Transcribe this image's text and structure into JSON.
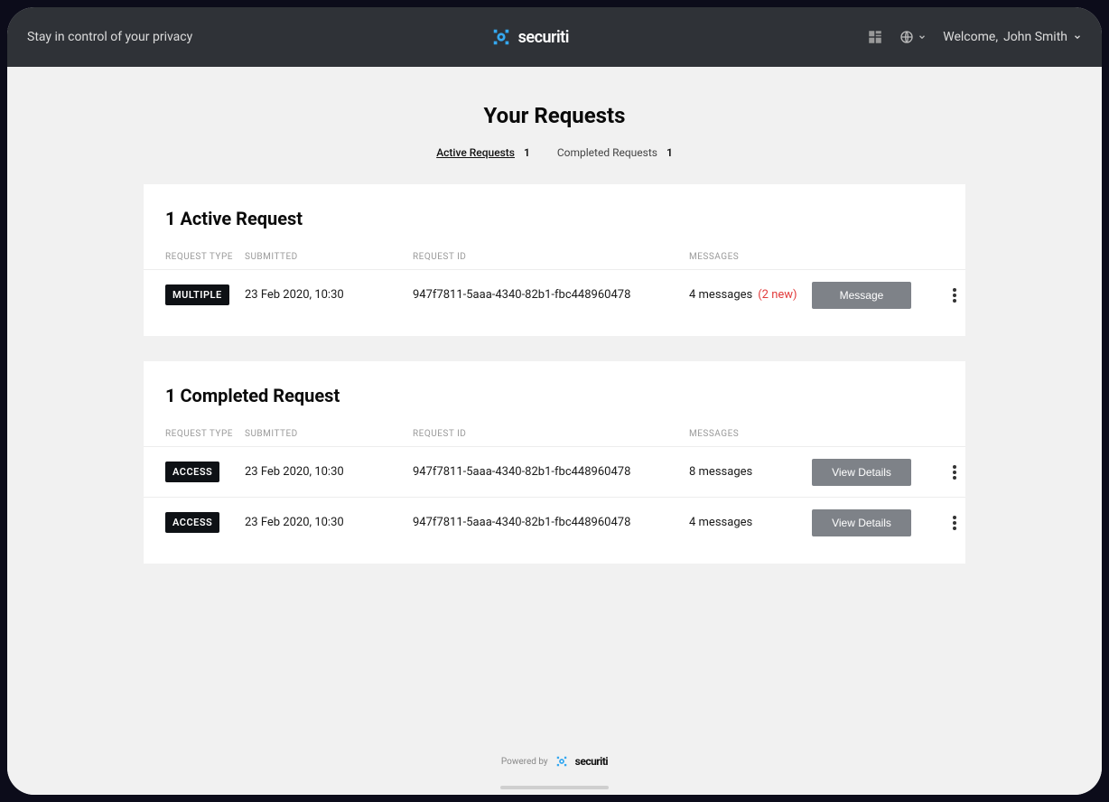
{
  "header": {
    "tagline": "Stay in control of your privacy",
    "brand": "securiti",
    "welcome_prefix": "Welcome, ",
    "user_name": "John Smith"
  },
  "page": {
    "title": "Your Requests",
    "tabs": {
      "active": {
        "label": "Active Requests",
        "count": "1"
      },
      "completed": {
        "label": "Completed Requests",
        "count": "1"
      }
    }
  },
  "columns": {
    "type": "REQUEST TYPE",
    "submitted": "SUBMITTED",
    "id": "REQUEST ID",
    "messages": "MESSAGES"
  },
  "active_section": {
    "title": "1 Active Request",
    "rows": [
      {
        "type": "MULTIPLE",
        "submitted": "23 Feb 2020, 10:30",
        "id": "947f7811-5aaa-4340-82b1-fbc448960478",
        "messages": "4 messages",
        "messages_new": "(2 new)",
        "button": "Message"
      }
    ]
  },
  "completed_section": {
    "title": "1 Completed Request",
    "rows": [
      {
        "type": "ACCESS",
        "submitted": "23 Feb 2020, 10:30",
        "id": "947f7811-5aaa-4340-82b1-fbc448960478",
        "messages": "8 messages",
        "button": "View Details"
      },
      {
        "type": "ACCESS",
        "submitted": "23 Feb 2020, 10:30",
        "id": "947f7811-5aaa-4340-82b1-fbc448960478",
        "messages": "4 messages",
        "button": "View Details"
      }
    ]
  },
  "footer": {
    "powered": "Powered by",
    "brand": "securiti"
  }
}
